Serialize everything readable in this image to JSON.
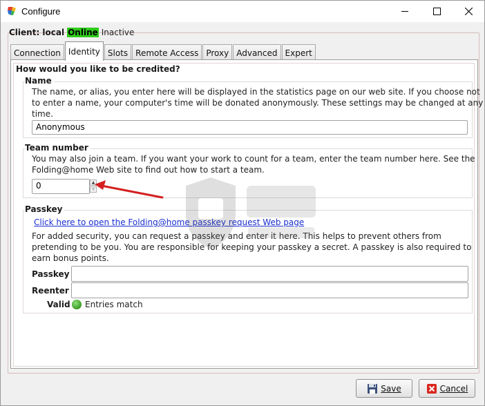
{
  "window": {
    "title": "Configure",
    "controls": {
      "minimize": "minimize",
      "maximize": "maximize",
      "close": "close"
    }
  },
  "client": {
    "label": "Client: local",
    "status_online": "Online",
    "status_inactive": "Inactive"
  },
  "tabs": [
    {
      "label": "Connection",
      "active": false
    },
    {
      "label": "Identity",
      "active": true
    },
    {
      "label": "Slots",
      "active": false
    },
    {
      "label": "Remote Access",
      "active": false
    },
    {
      "label": "Proxy",
      "active": false
    },
    {
      "label": "Advanced",
      "active": false
    },
    {
      "label": "Expert",
      "active": false
    }
  ],
  "identity": {
    "group_title": "How would you like to be credited?",
    "name": {
      "title": "Name",
      "description_line1": "The name, or alias, you enter here will be displayed in the statistics page on our web site.  If you choose not",
      "description_line2": "to enter a name, your computer's time will be donated anonymously.  These settings may be changed at any",
      "description_line3": "time.",
      "value": "Anonymous"
    },
    "team": {
      "title": "Team number",
      "description_line1": "You may also join a team.  If you want your work to count for a team, enter the team number here.  See the",
      "description_line2": "Folding@home Web site to find out how to start a team.",
      "value": "0"
    },
    "passkey": {
      "title": "Passkey",
      "link": "Click here to open the Folding@home passkey request Web page",
      "description_line1": "For added security, you can request a passkey and enter it here.  This helps to prevent others from",
      "description_line2": "pretending to be you.  You are responsible for keeping your passkey a secret.  A passkey is also required to",
      "description_line3": "earn bonus points.",
      "passkey_label": "Passkey",
      "passkey_value": "",
      "reenter_label": "Reenter",
      "reenter_value": "",
      "valid_label": "Valid",
      "valid_status": "Entries match"
    }
  },
  "buttons": {
    "save": "Save",
    "cancel": "Cancel"
  },
  "colors": {
    "online": "#2ecc1a",
    "link": "#1a2fd0",
    "annotation_arrow": "#d42020",
    "valid_indicator": "#3a9a22"
  }
}
